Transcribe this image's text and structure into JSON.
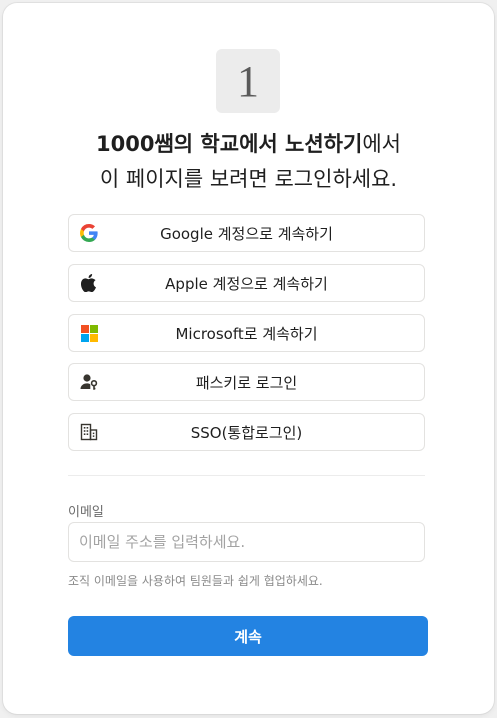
{
  "logo": {
    "text": "1"
  },
  "heading": {
    "line1_bold": "1000쌤의 학교에서 노션하기",
    "line1_rest": "에서",
    "line2": "이 페이지를 보려면 로그인하세요."
  },
  "auth_buttons": [
    {
      "label": "Google 계정으로 계속하기",
      "icon": "google-icon"
    },
    {
      "label": "Apple 계정으로 계속하기",
      "icon": "apple-icon"
    },
    {
      "label": "Microsoft로 계속하기",
      "icon": "microsoft-icon"
    },
    {
      "label": "패스키로 로그인",
      "icon": "passkey-icon"
    },
    {
      "label": "SSO(통합로그인)",
      "icon": "building-icon"
    }
  ],
  "email": {
    "label": "이메일",
    "placeholder": "이메일 주소를 입력하세요.",
    "hint": "조직 이메일을 사용하여 팀원들과 쉽게 협업하세요."
  },
  "continue_label": "계속",
  "colors": {
    "primary": "#2383e2",
    "background": "#f0f0f0",
    "card": "#ffffff",
    "text": "#1f1f1f",
    "muted": "#8a8a8a"
  }
}
